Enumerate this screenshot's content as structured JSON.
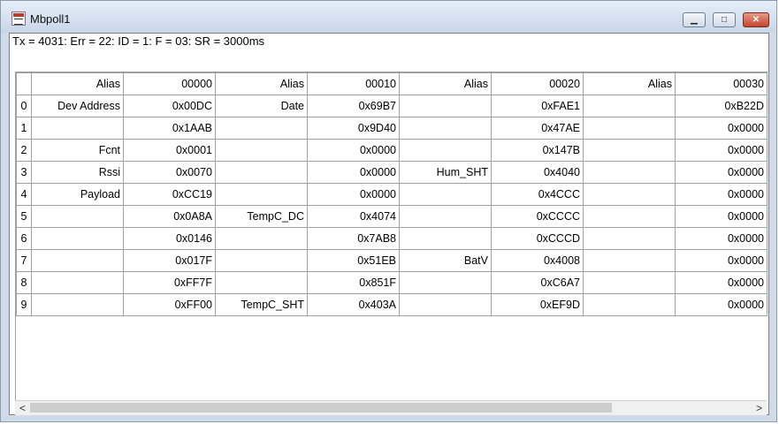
{
  "window": {
    "title": "Mbpoll1"
  },
  "status": "Tx = 4031: Err = 22: ID = 1: F = 03: SR = 3000ms",
  "grid": {
    "headers": [
      "Alias",
      "00000",
      "Alias",
      "00010",
      "Alias",
      "00020",
      "Alias",
      "00030"
    ],
    "rows": [
      {
        "num": "0",
        "cells": [
          "Dev Address",
          "0x00DC",
          "Date",
          "0x69B7",
          "",
          "0xFAE1",
          "",
          "0xB22D"
        ]
      },
      {
        "num": "1",
        "cells": [
          "",
          "0x1AAB",
          "",
          "0x9D40",
          "",
          "0x47AE",
          "",
          "0x0000"
        ]
      },
      {
        "num": "2",
        "cells": [
          "Fcnt",
          "0x0001",
          "",
          "0x0000",
          "",
          "0x147B",
          "",
          "0x0000"
        ]
      },
      {
        "num": "3",
        "cells": [
          "Rssi",
          "0x0070",
          "",
          "0x0000",
          "Hum_SHT",
          "0x4040",
          "",
          "0x0000"
        ]
      },
      {
        "num": "4",
        "cells": [
          "Payload",
          "0xCC19",
          "",
          "0x0000",
          "",
          "0x4CCC",
          "",
          "0x0000"
        ]
      },
      {
        "num": "5",
        "cells": [
          "",
          "0x0A8A",
          "TempC_DC",
          "0x4074",
          "",
          "0xCCCC",
          "",
          "0x0000"
        ]
      },
      {
        "num": "6",
        "cells": [
          "",
          "0x0146",
          "",
          "0x7AB8",
          "",
          "0xCCCD",
          "",
          "0x0000"
        ]
      },
      {
        "num": "7",
        "cells": [
          "",
          "0x017F",
          "",
          "0x51EB",
          "BatV",
          "0x4008",
          "",
          "0x0000"
        ]
      },
      {
        "num": "8",
        "cells": [
          "",
          "0xFF7F",
          "",
          "0x851F",
          "",
          "0xC6A7",
          "",
          "0x0000"
        ]
      },
      {
        "num": "9",
        "cells": [
          "",
          "0xFF00",
          "TempC_SHT",
          "0x403A",
          "",
          "0xEF9D",
          "",
          "0x0000"
        ]
      }
    ]
  },
  "scrollbar": {
    "left_icon": "scroll-left-icon",
    "right_icon": "scroll-right-icon"
  }
}
